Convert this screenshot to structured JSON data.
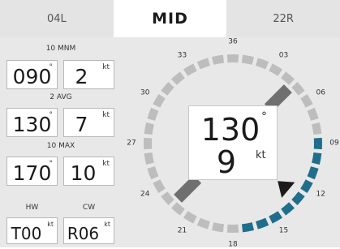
{
  "tabs": {
    "left": "04L",
    "center": "MID",
    "right": "22R"
  },
  "readouts": {
    "mnm": {
      "label": "10 MNM",
      "dir": "090",
      "dir_unit": "°",
      "speed": "2",
      "speed_unit": "kt"
    },
    "avg": {
      "label": "2 AVG",
      "dir": "130",
      "dir_unit": "°",
      "speed": "7",
      "speed_unit": "kt"
    },
    "max": {
      "label": "10 MAX",
      "dir": "170",
      "dir_unit": "°",
      "speed": "10",
      "speed_unit": "kt"
    },
    "hw": {
      "label": "HW",
      "value": "T00",
      "unit": "kt"
    },
    "cw": {
      "label": "CW",
      "value": "R06",
      "unit": "kt"
    }
  },
  "compass": {
    "direction": "130",
    "direction_unit": "°",
    "speed": "9",
    "speed_unit": "kt",
    "headings": [
      "36",
      "03",
      "06",
      "09",
      "12",
      "15",
      "18",
      "21",
      "24",
      "27",
      "30",
      "33"
    ],
    "runway_heading_deg": 45,
    "arrow_heading_deg": 130,
    "variance_from_deg": 90,
    "variance_to_deg": 170,
    "colors": {
      "ring_gray": "#bdbdbd",
      "variance_blue": "#1f6e8c",
      "runway_gray": "#6f6f6f",
      "arrow": "#1a1a1a"
    }
  }
}
